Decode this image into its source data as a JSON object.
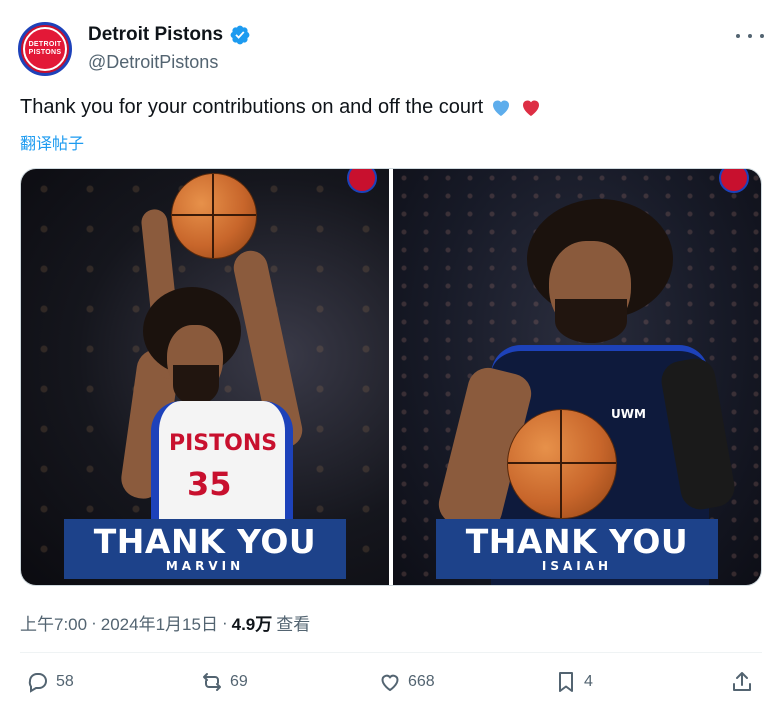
{
  "account": {
    "display_name": "Detroit Pistons",
    "handle": "@DetroitPistons",
    "avatar_text_line1": "DETROIT",
    "avatar_text_line2": "PISTONS"
  },
  "tweet": {
    "text": "Thank you for your contributions on and off the court",
    "translate_label": "翻译帖子",
    "emoji": [
      "blue-heart-icon",
      "red-heart-icon"
    ]
  },
  "media": {
    "left": {
      "jersey_text": "PISTONS",
      "jersey_number": "35",
      "banner_title": "THANK YOU",
      "banner_name": "MARVIN"
    },
    "right": {
      "jersey_text": "UWM",
      "banner_title": "THANK YOU",
      "banner_name": "ISAIAH"
    }
  },
  "meta": {
    "time": "上午7:00",
    "separator": "·",
    "date": "2024年1月15日",
    "views_count": "4.9万",
    "views_label": "查看"
  },
  "actions": {
    "replies": "58",
    "reposts": "69",
    "likes": "668",
    "bookmarks": "4"
  },
  "colors": {
    "brand_blue": "#1d428a",
    "brand_red": "#c8102e",
    "link": "#1d9bf0",
    "muted": "#536471"
  }
}
